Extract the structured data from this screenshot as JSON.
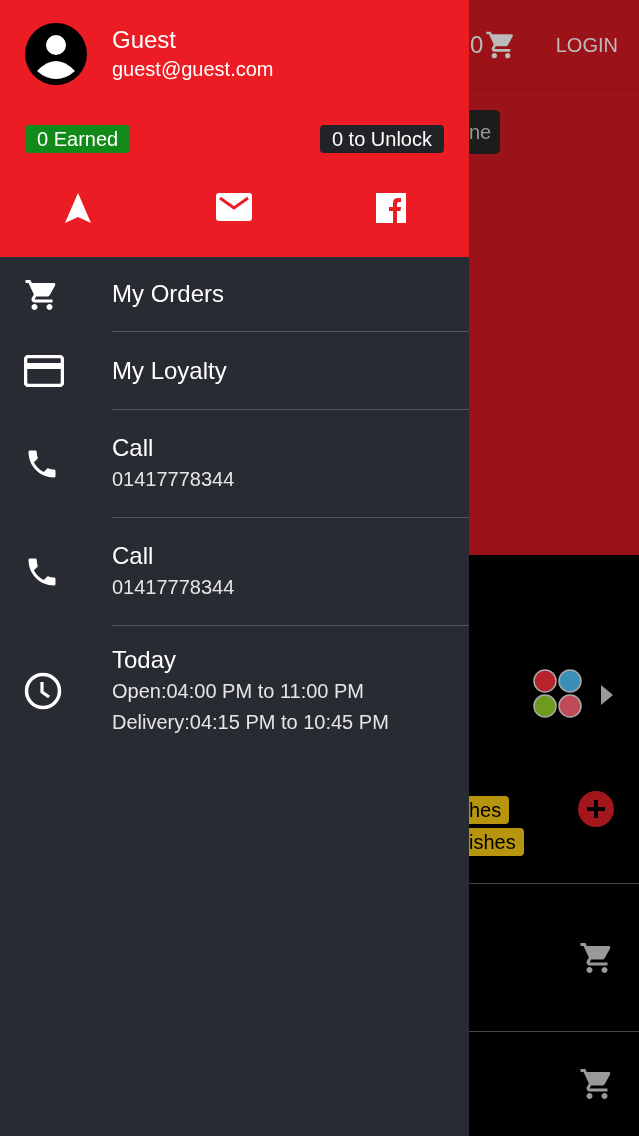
{
  "drawer": {
    "user": {
      "name": "Guest",
      "email": "guest@guest.com"
    },
    "badges": [
      {
        "label": "0 Earned",
        "color": "#128a1a"
      },
      {
        "label": "0 to Unlock",
        "color": "#222326"
      }
    ],
    "menu": [
      {
        "kind": "orders",
        "title": "My Orders"
      },
      {
        "kind": "loyalty",
        "title": "My Loyalty"
      },
      {
        "kind": "call",
        "title": "Call",
        "lines": [
          "01417778344"
        ]
      },
      {
        "kind": "call",
        "title": "Call",
        "lines": [
          "01417778344"
        ]
      },
      {
        "kind": "hours",
        "title": "Today",
        "lines": [
          "Open:04:00 PM to 11:00 PM",
          "Delivery:04:15 PM to 10:45 PM"
        ]
      }
    ]
  },
  "background": {
    "cart_count": "0",
    "login": "LOGIN",
    "chip": "ne",
    "tags": [
      "hes",
      "ishes"
    ]
  }
}
